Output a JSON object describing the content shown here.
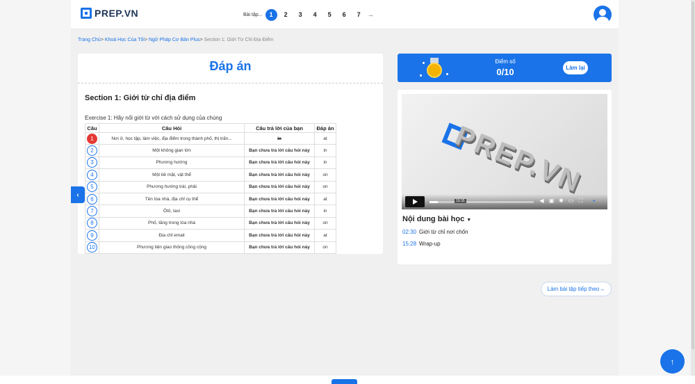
{
  "header": {
    "logo_text": "PREP.VN",
    "pager_label": "Bài tập...",
    "pages": [
      "1",
      "2",
      "3",
      "4",
      "5",
      "6",
      "7"
    ],
    "active_page": "1",
    "next_arrow": "→"
  },
  "breadcrumb": {
    "items": [
      "Trang Chủ",
      "Khoá Học Của Tôi",
      "Ngữ Pháp Cơ Bản Plus"
    ],
    "separator": ">",
    "current": "Section 1: Giới Từ Chỉ Địa Điểm"
  },
  "answer": {
    "title": "Đáp án",
    "section_title": "Section 1: Giới từ chỉ địa điểm",
    "exercise_title": "Exercise 1: Hãy nối giới từ với cách sử dụng của chúng",
    "headers": [
      "Câu",
      "Câu Hỏi",
      "Câu trả lời của bạn",
      "Đáp án"
    ],
    "rows": [
      {
        "num": "1",
        "question": "Nơi ở, học tập, làm việc, địa điểm trong thành phố, thị trấn...",
        "user_answer": "in",
        "answer": "at",
        "state": "wrong"
      },
      {
        "num": "2",
        "question": "Một không gian lớn",
        "user_answer": "Bạn chưa trả lời câu hỏi này",
        "answer": "in",
        "state": "none"
      },
      {
        "num": "3",
        "question": "Phương hướng",
        "user_answer": "Bạn chưa trả lời câu hỏi này",
        "answer": "in",
        "state": "none"
      },
      {
        "num": "4",
        "question": "Một bề mặt, vật thể",
        "user_answer": "Bạn chưa trả lời câu hỏi này",
        "answer": "on",
        "state": "none"
      },
      {
        "num": "5",
        "question": "Phương hướng trái, phải",
        "user_answer": "Bạn chưa trả lời câu hỏi này",
        "answer": "on",
        "state": "none"
      },
      {
        "num": "6",
        "question": "Tên tòa nhà, địa chỉ cụ thể",
        "user_answer": "Bạn chưa trả lời câu hỏi này",
        "answer": "at",
        "state": "none"
      },
      {
        "num": "7",
        "question": "Ôtô, taxi",
        "user_answer": "Bạn chưa trả lời câu hỏi này",
        "answer": "in",
        "state": "none"
      },
      {
        "num": "8",
        "question": "Phố, tầng trong tòa nhà",
        "user_answer": "Bạn chưa trả lời câu hỏi này",
        "answer": "on",
        "state": "none"
      },
      {
        "num": "9",
        "question": "Địa chỉ email",
        "user_answer": "Bạn chưa trả lời câu hỏi này",
        "answer": "at",
        "state": "none"
      },
      {
        "num": "10",
        "question": "Phương tiện giao thông công cộng",
        "user_answer": "Bạn chưa trả lời câu hỏi này",
        "answer": "on",
        "state": "none"
      }
    ]
  },
  "side_tab_icon": "‹",
  "score": {
    "label": "Điểm số",
    "value": "0/10",
    "retry_label": "Làm lại"
  },
  "video": {
    "logo_text": "PREP.VN",
    "hover_time": "19:35",
    "progress": 0.08
  },
  "toc": {
    "title": "Nội dung bài học",
    "items": [
      {
        "time": "02:30",
        "label": "Giới từ chỉ nơi chốn"
      },
      {
        "time": "15:28",
        "label": "Wrap-up"
      }
    ]
  },
  "next_button": "Làm bài tập tiếp theo→",
  "fab_icon": "↑",
  "colors": {
    "primary": "#1a73e8",
    "wrong": "#e53935",
    "medal": "#f5b301"
  }
}
